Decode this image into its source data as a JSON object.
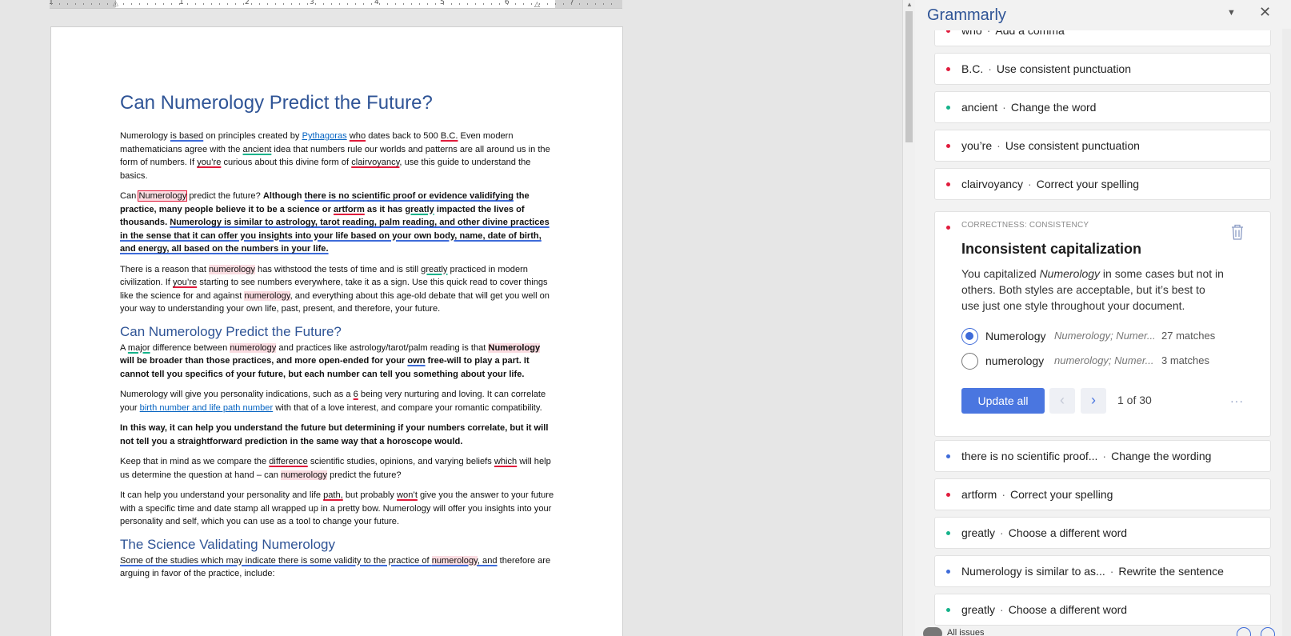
{
  "ruler": {
    "numbers": [
      "1",
      "1",
      "2",
      "3",
      "4",
      "5",
      "6",
      "7"
    ]
  },
  "document": {
    "title": "Can Numerology Predict the Future?",
    "p1": {
      "t1": "Numerology ",
      "is_based": "is based",
      "t2": " on principles created by ",
      "pythagoras": "Pythagoras",
      "sp": " ",
      "who": "who",
      "t3": " dates back to 500 ",
      "bc": "B.C.",
      "t4": " Even modern mathematicians agree with the ",
      "ancient": "ancient",
      "t5": " idea that numbers rule our worlds and patterns are all around us in the form of numbers. If ",
      "youre": "you’re",
      "t6": " curious about this divine form of ",
      "clairvoyancy": "clairvoyancy",
      "t7": ", use this guide to understand the basics."
    },
    "p2": {
      "can": "Can ",
      "numerology": "Numerology",
      "t1": " predict the future? ",
      "b1": "Although ",
      "no_proof": "there is no scientific proof or evidence validifying",
      "b2": " the practice, many people believe it to be a science or ",
      "artform": "artform",
      "b3": " as it has ",
      "greatly": "greatly",
      "b4": " impacted the lives of thousands. ",
      "similar": "Numerology is similar to astrology, tarot reading, palm reading, and other divine practices in the sense that it can offer you insights into your life based on your own body, name, date of birth, and energy, all based on the numbers in your life."
    },
    "p3": {
      "t1": "There is a reason that ",
      "numerology": "numerology",
      "t2": " has withstood the tests of time and is still ",
      "greatly": "greatly",
      "t3": " practiced in modern civilization. If ",
      "youre": "you’re",
      "t4": " starting to see numbers everywhere, take it as a sign. Use this quick read to cover things like the science for and against ",
      "numerology2": "numerology",
      "t5": ", and everything about this age-old debate that will get you well on your way to understanding your own life, past, present, and therefore, your future."
    },
    "h2a": "Can Numerology Predict the Future?",
    "p4": {
      "t1": "A ",
      "major": "major",
      "t2": " difference between ",
      "numerology": "numerology",
      "t3": " and practices like astrology/tarot/palm reading is that ",
      "b_numerology": "Numerology",
      "b1": " will be broader than those practices, and more open-ended for your ",
      "own": "own",
      "b2": " free-will to play a part. It cannot tell you specifics of your future, but each number can tell you something about your life."
    },
    "p5": {
      "t1": "Numerology will give you personality indications, such as a ",
      "six": "6",
      "t2": " being very nurturing and loving. It can correlate your ",
      "link": "birth number and life path number",
      "t3": " with that of a love interest, and compare your romantic compatibility."
    },
    "p6": "In this way, it can help you understand the future but determining if your numbers correlate, but it will not tell you a straightforward prediction in the same way that a horoscope would.",
    "p7": {
      "t1": "Keep that in mind as we compare the ",
      "difference": "difference",
      "t2": " scientific studies, opinions, and varying beliefs ",
      "which": "which",
      "t3": " will help us determine the question at hand – can ",
      "numerology": "numerology",
      "t4": " predict the future?"
    },
    "p8": {
      "t1": "It can help you understand your personality and life ",
      "path": "path,",
      "t2": " but probably ",
      "wont": "won’t",
      "t3": " give you the answer to your future with a specific time and date stamp all wrapped up in a pretty bow. Numerology will offer you insights into your personality and self, which you can use as a tool to change your future."
    },
    "h2b": "The Science Validating Numerology",
    "p9": {
      "t1": "Some of the studies which may indicate there is some validity to the practice of ",
      "numerology": "numerology",
      "t2": ", and",
      "t3": " therefore are arguing in favor of the practice, include:"
    }
  },
  "grammarly": {
    "title": "Grammarly",
    "cards_top": [
      {
        "word": "who",
        "action": "Add a comma",
        "color": "red"
      },
      {
        "word": "B.C.",
        "action": "Use consistent punctuation",
        "color": "red"
      },
      {
        "word": "ancient",
        "action": "Change the word",
        "color": "green"
      },
      {
        "word": "you’re",
        "action": "Use consistent punctuation",
        "color": "red"
      },
      {
        "word": "clairvoyancy",
        "action": "Correct your spelling",
        "color": "red"
      }
    ],
    "expanded": {
      "category": "CORRECTNESS: CONSISTENCY",
      "title": "Inconsistent capitalization",
      "body_1": "You capitalized ",
      "body_word": "Numerology",
      "body_2": " in some cases but not in others. Both styles are acceptable, but it’s best to use just one style throughout your document.",
      "options": [
        {
          "word": "Numerology",
          "variants": "Numerology; Numer...",
          "matches": "27 matches",
          "selected": true
        },
        {
          "word": "numerology",
          "variants": "numerology; Numer...",
          "matches": "3 matches",
          "selected": false
        }
      ],
      "update_label": "Update all",
      "prev_icon": "‹",
      "next_icon": "›",
      "counter": "1 of 30",
      "more_icon": "···"
    },
    "cards_bottom": [
      {
        "word": "there is no scientific proof...",
        "action": "Change the wording",
        "color": "blue"
      },
      {
        "word": "artform",
        "action": "Correct your spelling",
        "color": "red"
      },
      {
        "word": "greatly",
        "action": "Choose a different word",
        "color": "green"
      },
      {
        "word": "Numerology is similar to as...",
        "action": "Rewrite the sentence",
        "color": "blue"
      },
      {
        "word": "greatly",
        "action": "Choose a different word",
        "color": "green"
      }
    ],
    "footer": {
      "label": "All issues"
    },
    "colors": {
      "red": "#e01b3c",
      "green": "#15b28a",
      "blue": "#3e6bd9",
      "accent": "#4a76e0"
    }
  }
}
